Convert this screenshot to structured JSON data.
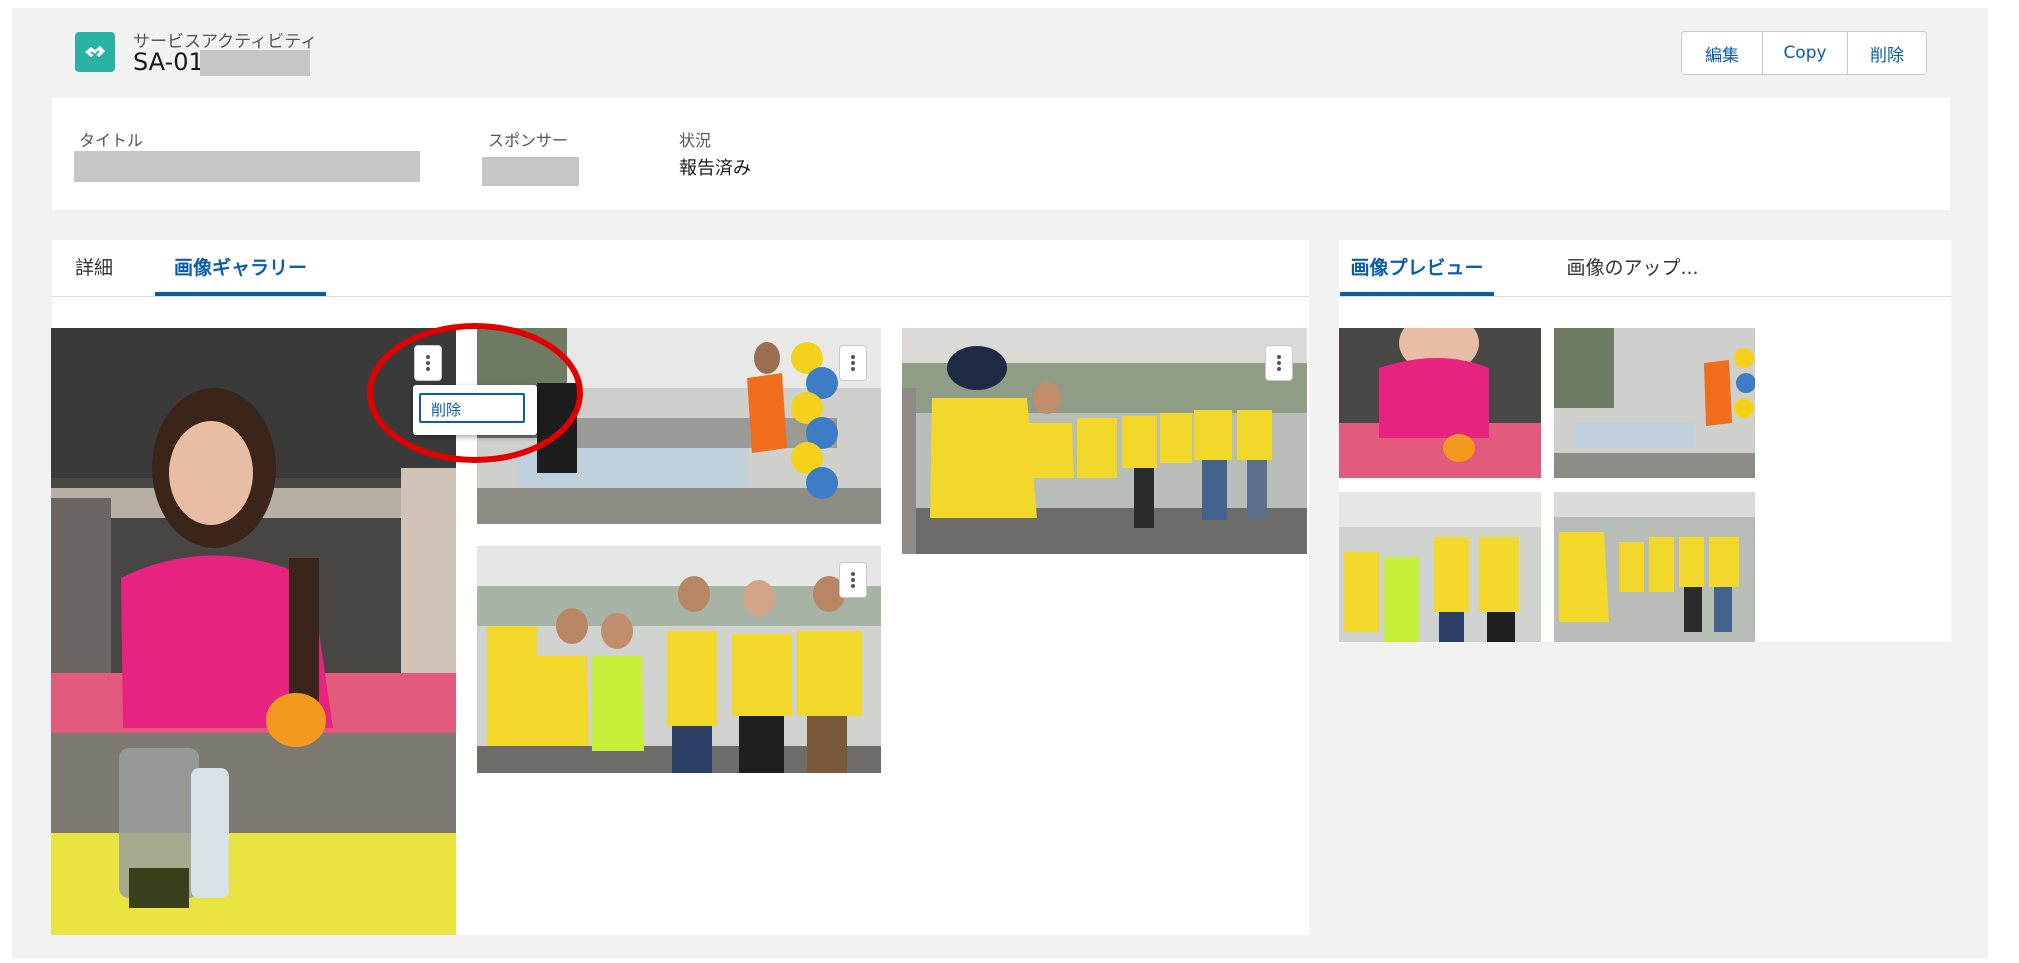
{
  "header": {
    "object_type": "サービスアクティビティ",
    "record_name": "SA-01",
    "actions": [
      "編集",
      "Copy",
      "削除"
    ]
  },
  "highlights": {
    "title_label": "タイトル",
    "sponsor_label": "スポンサー",
    "status_label": "状況",
    "status_value": "報告済み"
  },
  "main_tabs": [
    "詳細",
    "画像ギャラリー"
  ],
  "gallery": {
    "photo_menu": {
      "delete_label": "削除"
    }
  },
  "side_tabs": [
    "画像プレビュー",
    "画像のアップ..."
  ],
  "colors": {
    "accent": "#0b5cab",
    "object_icon": "#2ab2a4",
    "annotation": "#e00000"
  }
}
